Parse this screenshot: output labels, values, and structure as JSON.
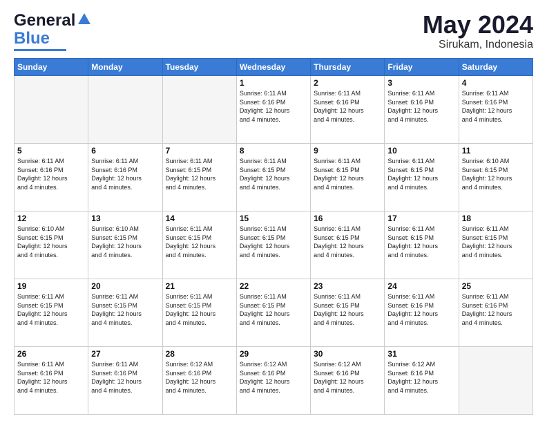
{
  "header": {
    "logo_line1": "General",
    "logo_line2": "Blue",
    "title": "May 2024",
    "subtitle": "Sirukam, Indonesia"
  },
  "calendar": {
    "days_of_week": [
      "Sunday",
      "Monday",
      "Tuesday",
      "Wednesday",
      "Thursday",
      "Friday",
      "Saturday"
    ],
    "weeks": [
      [
        {
          "num": "",
          "empty": true
        },
        {
          "num": "",
          "empty": true
        },
        {
          "num": "",
          "empty": true
        },
        {
          "num": "1",
          "info": "Sunrise: 6:11 AM\nSunset: 6:16 PM\nDaylight: 12 hours\nand 4 minutes."
        },
        {
          "num": "2",
          "info": "Sunrise: 6:11 AM\nSunset: 6:16 PM\nDaylight: 12 hours\nand 4 minutes."
        },
        {
          "num": "3",
          "info": "Sunrise: 6:11 AM\nSunset: 6:16 PM\nDaylight: 12 hours\nand 4 minutes."
        },
        {
          "num": "4",
          "info": "Sunrise: 6:11 AM\nSunset: 6:16 PM\nDaylight: 12 hours\nand 4 minutes."
        }
      ],
      [
        {
          "num": "5",
          "info": "Sunrise: 6:11 AM\nSunset: 6:16 PM\nDaylight: 12 hours\nand 4 minutes."
        },
        {
          "num": "6",
          "info": "Sunrise: 6:11 AM\nSunset: 6:16 PM\nDaylight: 12 hours\nand 4 minutes."
        },
        {
          "num": "7",
          "info": "Sunrise: 6:11 AM\nSunset: 6:15 PM\nDaylight: 12 hours\nand 4 minutes."
        },
        {
          "num": "8",
          "info": "Sunrise: 6:11 AM\nSunset: 6:15 PM\nDaylight: 12 hours\nand 4 minutes."
        },
        {
          "num": "9",
          "info": "Sunrise: 6:11 AM\nSunset: 6:15 PM\nDaylight: 12 hours\nand 4 minutes."
        },
        {
          "num": "10",
          "info": "Sunrise: 6:11 AM\nSunset: 6:15 PM\nDaylight: 12 hours\nand 4 minutes."
        },
        {
          "num": "11",
          "info": "Sunrise: 6:10 AM\nSunset: 6:15 PM\nDaylight: 12 hours\nand 4 minutes."
        }
      ],
      [
        {
          "num": "12",
          "info": "Sunrise: 6:10 AM\nSunset: 6:15 PM\nDaylight: 12 hours\nand 4 minutes."
        },
        {
          "num": "13",
          "info": "Sunrise: 6:10 AM\nSunset: 6:15 PM\nDaylight: 12 hours\nand 4 minutes."
        },
        {
          "num": "14",
          "info": "Sunrise: 6:11 AM\nSunset: 6:15 PM\nDaylight: 12 hours\nand 4 minutes."
        },
        {
          "num": "15",
          "info": "Sunrise: 6:11 AM\nSunset: 6:15 PM\nDaylight: 12 hours\nand 4 minutes."
        },
        {
          "num": "16",
          "info": "Sunrise: 6:11 AM\nSunset: 6:15 PM\nDaylight: 12 hours\nand 4 minutes."
        },
        {
          "num": "17",
          "info": "Sunrise: 6:11 AM\nSunset: 6:15 PM\nDaylight: 12 hours\nand 4 minutes."
        },
        {
          "num": "18",
          "info": "Sunrise: 6:11 AM\nSunset: 6:15 PM\nDaylight: 12 hours\nand 4 minutes."
        }
      ],
      [
        {
          "num": "19",
          "info": "Sunrise: 6:11 AM\nSunset: 6:15 PM\nDaylight: 12 hours\nand 4 minutes."
        },
        {
          "num": "20",
          "info": "Sunrise: 6:11 AM\nSunset: 6:15 PM\nDaylight: 12 hours\nand 4 minutes."
        },
        {
          "num": "21",
          "info": "Sunrise: 6:11 AM\nSunset: 6:15 PM\nDaylight: 12 hours\nand 4 minutes."
        },
        {
          "num": "22",
          "info": "Sunrise: 6:11 AM\nSunset: 6:15 PM\nDaylight: 12 hours\nand 4 minutes."
        },
        {
          "num": "23",
          "info": "Sunrise: 6:11 AM\nSunset: 6:15 PM\nDaylight: 12 hours\nand 4 minutes."
        },
        {
          "num": "24",
          "info": "Sunrise: 6:11 AM\nSunset: 6:16 PM\nDaylight: 12 hours\nand 4 minutes."
        },
        {
          "num": "25",
          "info": "Sunrise: 6:11 AM\nSunset: 6:16 PM\nDaylight: 12 hours\nand 4 minutes."
        }
      ],
      [
        {
          "num": "26",
          "info": "Sunrise: 6:11 AM\nSunset: 6:16 PM\nDaylight: 12 hours\nand 4 minutes."
        },
        {
          "num": "27",
          "info": "Sunrise: 6:11 AM\nSunset: 6:16 PM\nDaylight: 12 hours\nand 4 minutes."
        },
        {
          "num": "28",
          "info": "Sunrise: 6:12 AM\nSunset: 6:16 PM\nDaylight: 12 hours\nand 4 minutes."
        },
        {
          "num": "29",
          "info": "Sunrise: 6:12 AM\nSunset: 6:16 PM\nDaylight: 12 hours\nand 4 minutes."
        },
        {
          "num": "30",
          "info": "Sunrise: 6:12 AM\nSunset: 6:16 PM\nDaylight: 12 hours\nand 4 minutes."
        },
        {
          "num": "31",
          "info": "Sunrise: 6:12 AM\nSunset: 6:16 PM\nDaylight: 12 hours\nand 4 minutes."
        },
        {
          "num": "",
          "empty": true
        }
      ]
    ]
  }
}
